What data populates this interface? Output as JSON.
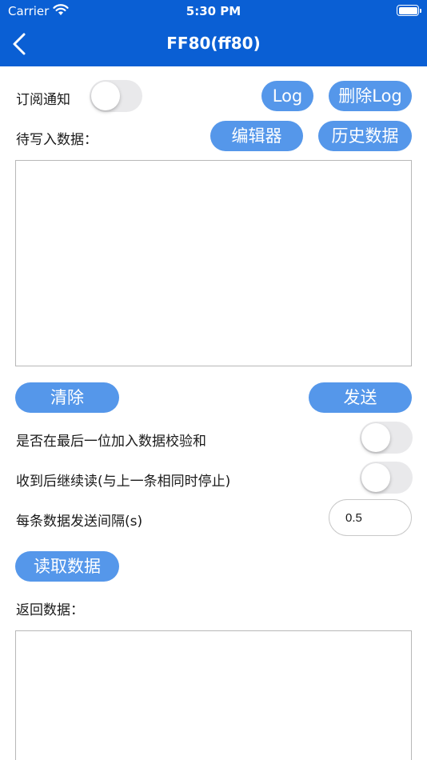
{
  "status_bar": {
    "carrier": "Carrier",
    "time": "5:30 PM"
  },
  "nav": {
    "title": "FF80(ff80)"
  },
  "subscribe": {
    "label": "订阅通知",
    "enabled": false
  },
  "buttons": {
    "log": "Log",
    "delete_log": "删除Log",
    "editor": "编辑器",
    "history": "历史数据",
    "clear": "清除",
    "send": "发送",
    "read": "读取数据"
  },
  "write": {
    "label": "待写入数据：",
    "value": ""
  },
  "options": {
    "checksum": {
      "label": "是否在最后一位加入数据校验和",
      "enabled": false
    },
    "continue_read": {
      "label": "收到后继续读(与上一条相同时停止)",
      "enabled": false
    },
    "interval": {
      "label": "每条数据发送间隔(s)",
      "value": "0.5"
    }
  },
  "response": {
    "label": "返回数据：",
    "value": ""
  },
  "colors": {
    "nav_bg": "#0a5fd4",
    "button_bg": "#5597ea",
    "toggle_off": "#e9e9eb"
  }
}
